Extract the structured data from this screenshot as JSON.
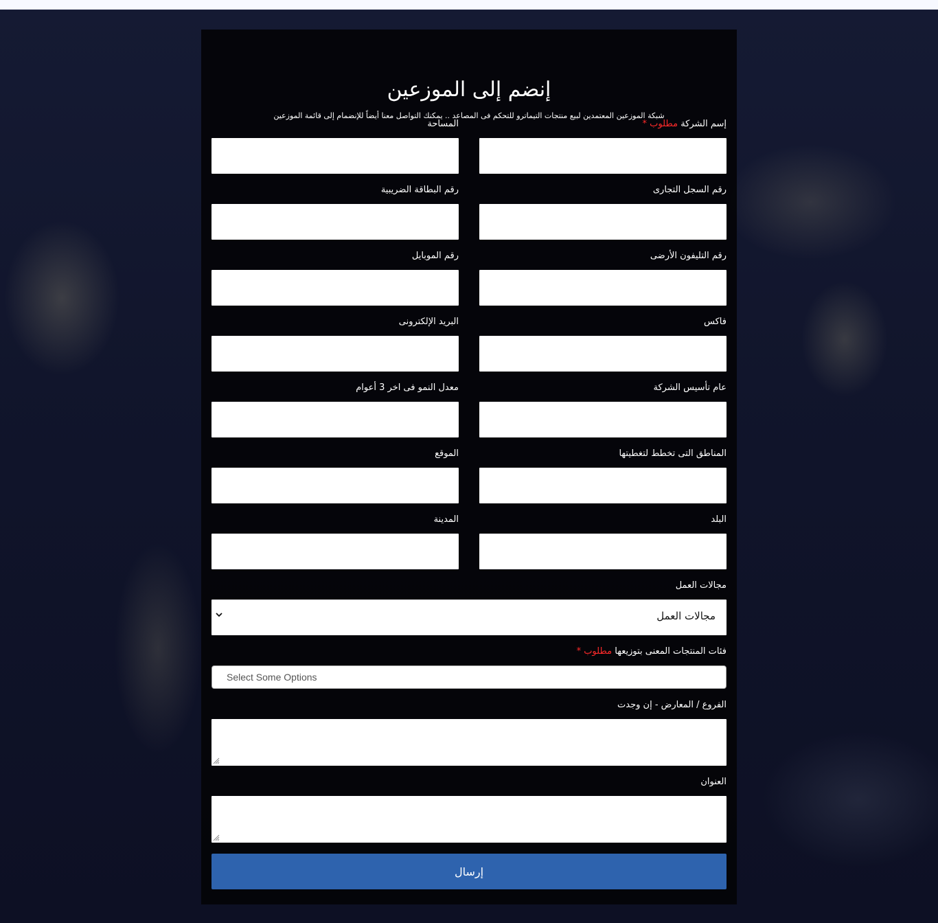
{
  "header": {
    "title": "إنضم إلى الموزعين",
    "subtitle": "شبكة الموزعين المعتمدين لبيع منتجات التيماترو للتحكم فى المصاعد .. يمكنك التواصل معنا أيضاً للإنضمام إلى قائمة الموزعين"
  },
  "required_text": "مطلوب *",
  "fields": {
    "company_name": "إسم الشركة",
    "area": "المساحة",
    "commercial_register": "رقم السجل التجارى",
    "tax_card": "رقم البطاقة الضريبية",
    "landline": "رقم التليفون الأرضى",
    "mobile": "رقم الموبايل",
    "fax": "فاكس",
    "email": "البريد الإلكترونى",
    "founding_year": "عام تأسيس الشركة",
    "growth_rate": "معدل النمو فى اخر 3 أعوام",
    "coverage_regions": "المناطق التى تخطط لتغطيتها",
    "website": "الموقع",
    "country": "البلد",
    "city": "المدينة",
    "business_fields": "مجالات العمل",
    "product_categories": "فئات المنتجات المعنى بتوزيعها",
    "branches": "الفروع / المعارض - إن وجدت",
    "address": "العنوان"
  },
  "business_fields_select": {
    "selected": "مجالات العمل"
  },
  "product_categories_multiselect": {
    "placeholder": "Select Some Options"
  },
  "submit_label": "إرسال"
}
